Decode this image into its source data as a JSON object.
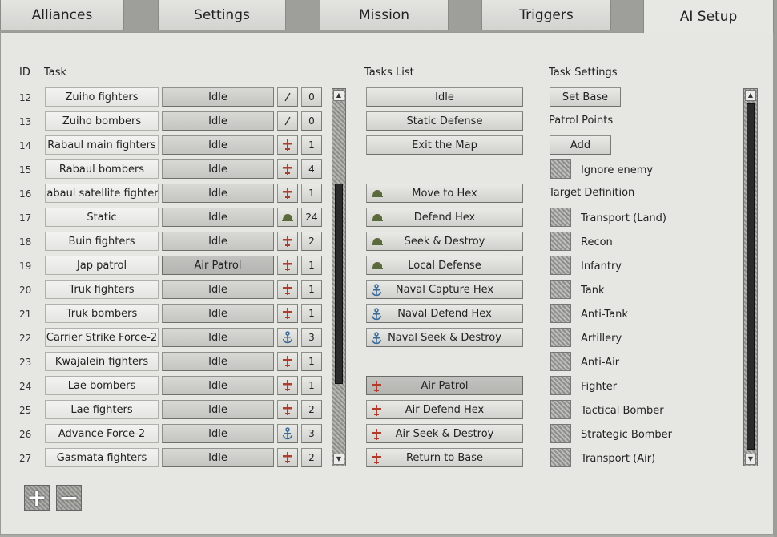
{
  "tabs": [
    {
      "label": "Alliances",
      "active": false
    },
    {
      "label": "Settings",
      "active": false
    },
    {
      "label": "Mission",
      "active": false
    },
    {
      "label": "Triggers",
      "active": false
    },
    {
      "label": "AI Setup",
      "active": true
    }
  ],
  "headers": {
    "id": "ID",
    "task": "Task",
    "tasks_list": "Tasks List",
    "task_settings": "Task Settings"
  },
  "colors": {
    "plane_icon": "#b03c2e",
    "tank_icon": "#5a6a3a",
    "ship_icon": "#3a6a9a"
  },
  "task_rows": [
    {
      "id": "12",
      "name": "Zuiho fighters",
      "status": "Idle",
      "icon": "slash",
      "count": "0",
      "selected": false
    },
    {
      "id": "13",
      "name": "Zuiho bombers",
      "status": "Idle",
      "icon": "slash",
      "count": "0",
      "selected": false
    },
    {
      "id": "14",
      "name": "Rabaul main fighters",
      "status": "Idle",
      "icon": "plane-icon",
      "count": "1",
      "selected": false
    },
    {
      "id": "15",
      "name": "Rabaul bombers",
      "status": "Idle",
      "icon": "plane-icon",
      "count": "4",
      "selected": false
    },
    {
      "id": "16",
      "name": "Rabaul satellite fighters",
      "status": "Idle",
      "icon": "plane-icon",
      "count": "1",
      "selected": false
    },
    {
      "id": "17",
      "name": "Static",
      "status": "Idle",
      "icon": "tank-icon",
      "count": "24",
      "selected": false
    },
    {
      "id": "18",
      "name": "Buin fighters",
      "status": "Idle",
      "icon": "plane-icon",
      "count": "2",
      "selected": false
    },
    {
      "id": "19",
      "name": "Jap patrol",
      "status": "Air Patrol",
      "icon": "plane-icon",
      "count": "1",
      "selected": true
    },
    {
      "id": "20",
      "name": "Truk fighters",
      "status": "Idle",
      "icon": "plane-icon",
      "count": "1",
      "selected": false
    },
    {
      "id": "21",
      "name": "Truk bombers",
      "status": "Idle",
      "icon": "plane-icon",
      "count": "1",
      "selected": false
    },
    {
      "id": "22",
      "name": "Carrier Strike Force-2",
      "status": "Idle",
      "icon": "ship-icon",
      "count": "3",
      "selected": false
    },
    {
      "id": "23",
      "name": "Kwajalein fighters",
      "status": "Idle",
      "icon": "plane-icon",
      "count": "1",
      "selected": false
    },
    {
      "id": "24",
      "name": "Lae bombers",
      "status": "Idle",
      "icon": "plane-icon",
      "count": "1",
      "selected": false
    },
    {
      "id": "25",
      "name": "Lae fighters",
      "status": "Idle",
      "icon": "plane-icon",
      "count": "2",
      "selected": false
    },
    {
      "id": "26",
      "name": "Advance Force-2",
      "status": "Idle",
      "icon": "ship-icon",
      "count": "3",
      "selected": false
    },
    {
      "id": "27",
      "name": "Gasmata fighters",
      "status": "Idle",
      "icon": "plane-icon",
      "count": "2",
      "selected": false
    }
  ],
  "tasks_list": [
    {
      "label": "Idle",
      "icon": "",
      "slot": 0,
      "selected": false
    },
    {
      "label": "Static Defense",
      "icon": "",
      "slot": 1,
      "selected": false
    },
    {
      "label": "Exit the Map",
      "icon": "",
      "slot": 2,
      "selected": false
    },
    {
      "label": "Move to Hex",
      "icon": "tank-icon",
      "slot": 4,
      "selected": false
    },
    {
      "label": "Defend Hex",
      "icon": "tank-icon",
      "slot": 5,
      "selected": false
    },
    {
      "label": "Seek & Destroy",
      "icon": "tank-icon",
      "slot": 6,
      "selected": false
    },
    {
      "label": "Local Defense",
      "icon": "tank-icon",
      "slot": 7,
      "selected": false
    },
    {
      "label": "Naval Capture Hex",
      "icon": "ship-icon",
      "slot": 8,
      "selected": false
    },
    {
      "label": "Naval Defend Hex",
      "icon": "ship-icon",
      "slot": 9,
      "selected": false
    },
    {
      "label": "Naval Seek & Destroy",
      "icon": "ship-icon",
      "slot": 10,
      "selected": false
    },
    {
      "label": "Air Patrol",
      "icon": "plane-icon",
      "slot": 12,
      "selected": true
    },
    {
      "label": "Air Defend Hex",
      "icon": "plane-icon",
      "slot": 13,
      "selected": false
    },
    {
      "label": "Air Seek & Destroy",
      "icon": "plane-icon",
      "slot": 14,
      "selected": false
    },
    {
      "label": "Return to Base",
      "icon": "plane-icon",
      "slot": 15,
      "selected": false
    }
  ],
  "settings": {
    "set_base_label": "Set Base",
    "patrol_points_label": "Patrol Points",
    "add_label": "Add",
    "ignore_enemy_label": "Ignore enemy",
    "target_definition_label": "Target Definition",
    "targets": [
      "Transport (Land)",
      "Recon",
      "Infantry",
      "Tank",
      "Anti-Tank",
      "Artillery",
      "Anti-Air",
      "Fighter",
      "Tactical Bomber",
      "Strategic Bomber",
      "Transport (Air)"
    ]
  },
  "footer": {
    "add_symbol": "+",
    "remove_symbol": "−"
  }
}
